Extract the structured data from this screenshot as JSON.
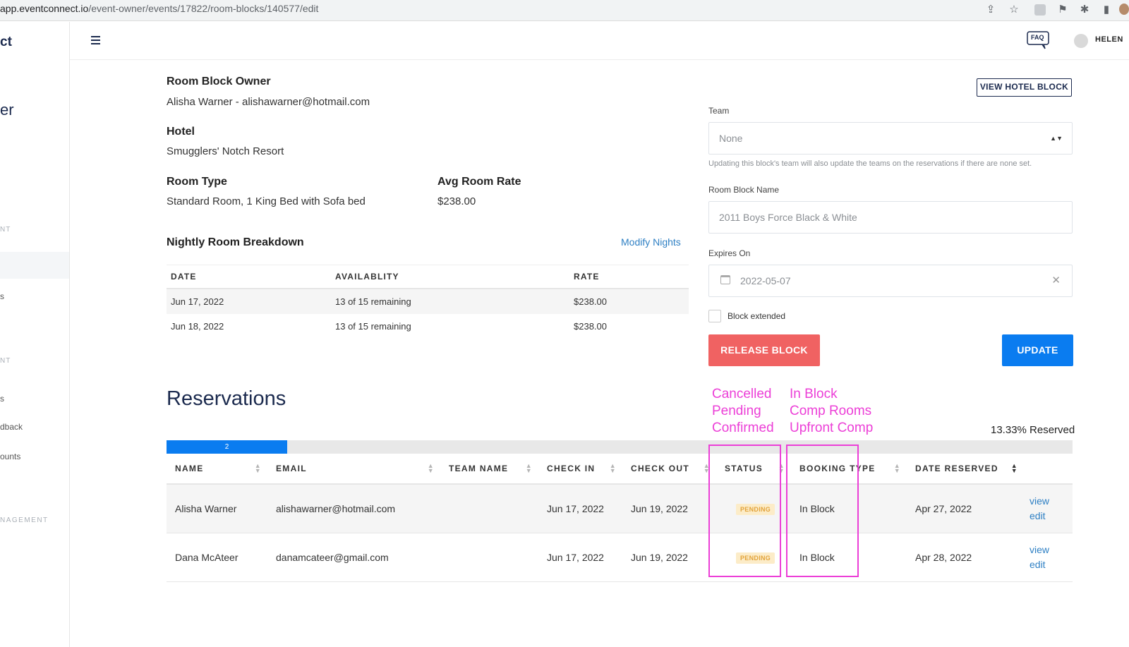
{
  "browser": {
    "url_host": "app.eventconnect.io",
    "url_path": "/event-owner/events/17822/room-blocks/140577/edit"
  },
  "sidebar": {
    "logo_fragment": "ct",
    "title_fragment": "er",
    "fragments": [
      "NT",
      "s",
      "NT",
      "s",
      "dback",
      "ounts",
      "NAGEMENT"
    ]
  },
  "topbar": {
    "faq_label": "FAQ",
    "user_name": "HELEN"
  },
  "details": {
    "owner_label": "Room Block Owner",
    "owner_value": "Alisha Warner - alishawarner@hotmail.com",
    "hotel_label": "Hotel",
    "hotel_value": "Smugglers' Notch Resort",
    "room_type_label": "Room Type",
    "room_type_value": "Standard Room, 1 King Bed with Sofa bed",
    "avg_rate_label": "Avg Room Rate",
    "avg_rate_value": "$238.00",
    "nightly_label": "Nightly Room Breakdown",
    "modify_nights": "Modify Nights"
  },
  "nightly": {
    "headers": [
      "DATE",
      "AVAILABLITY",
      "RATE"
    ],
    "rows": [
      {
        "date": "Jun 17, 2022",
        "availability": "13 of 15 remaining",
        "rate": "$238.00"
      },
      {
        "date": "Jun 18, 2022",
        "availability": "13 of 15 remaining",
        "rate": "$238.00"
      }
    ]
  },
  "form": {
    "view_hotel_block": "VIEW HOTEL BLOCK",
    "team_label": "Team",
    "team_value": "None",
    "team_hint": "Updating this block's team will also update the teams on the reservations if there are none set.",
    "block_name_label": "Room Block Name",
    "block_name_placeholder": "2011 Boys Force Black & White",
    "expires_label": "Expires On",
    "expires_value": "2022-05-07",
    "block_extended_label": "Block extended",
    "release_button": "RELEASE BLOCK",
    "update_button": "UPDATE"
  },
  "reservations": {
    "title": "Reservations",
    "reserved_pct": "13.33% Reserved",
    "progress_label": "2",
    "progress_fraction": 0.1333,
    "headers": [
      "NAME",
      "EMAIL",
      "TEAM NAME",
      "CHECK IN",
      "CHECK OUT",
      "STATUS",
      "BOOKING TYPE",
      "DATE RESERVED"
    ],
    "rows": [
      {
        "name": "Alisha Warner",
        "email": "alishawarner@hotmail.com",
        "team": "",
        "check_in": "Jun 17, 2022",
        "check_out": "Jun 19, 2022",
        "status": "PENDING",
        "booking_type": "In Block",
        "date_reserved": "Apr 27, 2022",
        "view": "view",
        "edit": "edit"
      },
      {
        "name": "Dana McAteer",
        "email": "danamcateer@gmail.com",
        "team": "",
        "check_in": "Jun 17, 2022",
        "check_out": "Jun 19, 2022",
        "status": "PENDING",
        "booking_type": "In Block",
        "date_reserved": "Apr 28, 2022",
        "view": "view",
        "edit": "edit"
      }
    ]
  },
  "annotations": {
    "status_options": [
      "Cancelled",
      "Pending",
      "Confirmed"
    ],
    "booking_options": [
      "In Block",
      "Comp Rooms",
      "Upfront Comp"
    ],
    "color": "#ec3fd7"
  },
  "colors": {
    "primary": "#0a7cf0",
    "danger": "#f06262",
    "navy": "#1b2a4e",
    "link": "#2f80c4"
  }
}
